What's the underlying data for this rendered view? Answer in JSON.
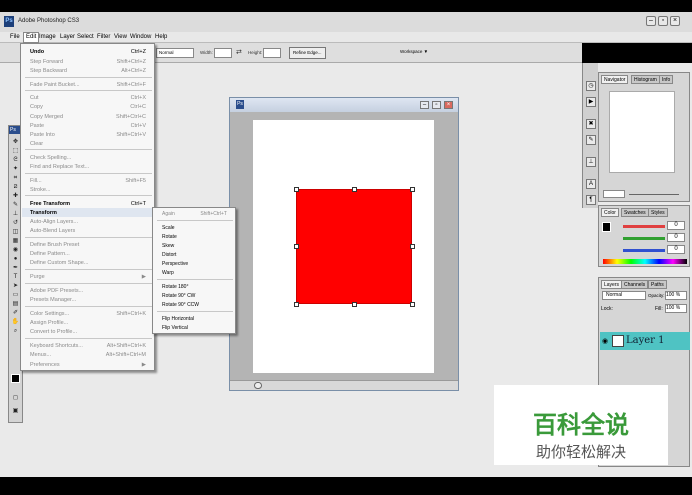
{
  "window": {
    "title": "Adobe Photoshop CS3",
    "logo": "Ps"
  },
  "menubar": {
    "items": [
      "File",
      "Edit",
      "Image",
      "Layer",
      "Select",
      "Filter",
      "View",
      "Window",
      "Help"
    ]
  },
  "options": {
    "style": "Normal",
    "width_label": "Width:",
    "height_label": "Height:",
    "refine_button": "Refine Edge...",
    "workspace_button": "Workspace ▼"
  },
  "toolbox": {
    "header": "Ps"
  },
  "edit_menu": {
    "items": [
      {
        "label": "Undo",
        "shortcut": "Ctrl+Z",
        "bold": true
      },
      {
        "label": "Step Forward",
        "shortcut": "Shift+Ctrl+Z",
        "disabled": true
      },
      {
        "label": "Step Backward",
        "shortcut": "Alt+Ctrl+Z",
        "disabled": true
      },
      {
        "label": "Fade Paint Bucket...",
        "shortcut": "Shift+Ctrl+F",
        "disabled": true
      },
      {
        "label": "Cut",
        "shortcut": "Ctrl+X",
        "disabled": true
      },
      {
        "label": "Copy",
        "shortcut": "Ctrl+C",
        "disabled": true
      },
      {
        "label": "Copy Merged",
        "shortcut": "Shift+Ctrl+C",
        "disabled": true
      },
      {
        "label": "Paste",
        "shortcut": "Ctrl+V",
        "disabled": true
      },
      {
        "label": "Paste Into",
        "shortcut": "Shift+Ctrl+V",
        "disabled": true
      },
      {
        "label": "Clear",
        "shortcut": "",
        "disabled": true
      },
      {
        "label": "Check Spelling...",
        "shortcut": "",
        "disabled": true
      },
      {
        "label": "Find and Replace Text...",
        "shortcut": "",
        "disabled": true
      },
      {
        "label": "Fill...",
        "shortcut": "Shift+F5",
        "disabled": true
      },
      {
        "label": "Stroke...",
        "shortcut": "",
        "disabled": true
      },
      {
        "label": "Free Transform",
        "shortcut": "Ctrl+T",
        "bold": true
      },
      {
        "label": "Transform",
        "shortcut": "",
        "bold": true
      },
      {
        "label": "Auto-Align Layers...",
        "shortcut": "",
        "disabled": true
      },
      {
        "label": "Auto-Blend Layers",
        "shortcut": "",
        "disabled": true
      },
      {
        "label": "Define Brush Preset",
        "shortcut": "",
        "disabled": true
      },
      {
        "label": "Define Pattern...",
        "shortcut": "",
        "disabled": true
      },
      {
        "label": "Define Custom Shape...",
        "shortcut": "",
        "disabled": true
      },
      {
        "label": "Purge",
        "shortcut": "▶",
        "disabled": true
      },
      {
        "label": "Adobe PDF Presets...",
        "shortcut": "",
        "disabled": true
      },
      {
        "label": "Presets Manager...",
        "shortcut": "",
        "disabled": true
      },
      {
        "label": "Color Settings...",
        "shortcut": "Shift+Ctrl+K",
        "disabled": true
      },
      {
        "label": "Assign Profile...",
        "shortcut": "",
        "disabled": true
      },
      {
        "label": "Convert to Profile...",
        "shortcut": "",
        "disabled": true
      },
      {
        "label": "Keyboard Shortcuts...",
        "shortcut": "Alt+Shift+Ctrl+K",
        "disabled": true
      },
      {
        "label": "Menus...",
        "shortcut": "Alt+Shift+Ctrl+M",
        "disabled": true
      },
      {
        "label": "Preferences",
        "shortcut": "▶",
        "disabled": true
      }
    ]
  },
  "transform_menu": {
    "items": [
      {
        "label": "Again",
        "shortcut": "Shift+Ctrl+T",
        "disabled": true
      },
      {
        "label": "Scale"
      },
      {
        "label": "Rotate"
      },
      {
        "label": "Skew"
      },
      {
        "label": "Distort"
      },
      {
        "label": "Perspective"
      },
      {
        "label": "Warp"
      },
      {
        "label": "Rotate 180°"
      },
      {
        "label": "Rotate 90° CW"
      },
      {
        "label": "Rotate 90° CCW"
      },
      {
        "label": "Flip Horizontal"
      },
      {
        "label": "Flip Vertical"
      }
    ]
  },
  "panels": {
    "navigator_tabs": [
      "Navigator",
      "Histogram",
      "Info"
    ],
    "color_tabs": [
      "Color",
      "Swatches",
      "Styles"
    ],
    "color_values": [
      "0",
      "0",
      "0"
    ],
    "layers_tabs": [
      "Layers",
      "Channels",
      "Paths"
    ],
    "blend_mode": "Normal",
    "opacity_label": "Opacity:",
    "opacity_value": "100 %",
    "lock_label": "Lock:",
    "fill_label": "Fill:",
    "fill_value": "100 %",
    "layer_name": "Layer 1"
  },
  "watermark": {
    "title": "百科全说",
    "subtitle": "助你轻松解决"
  },
  "colors": {
    "shape_fill": "#ff0000",
    "layer_highlight": "#4fc3c3",
    "watermark_green": "#3a9a3a"
  }
}
